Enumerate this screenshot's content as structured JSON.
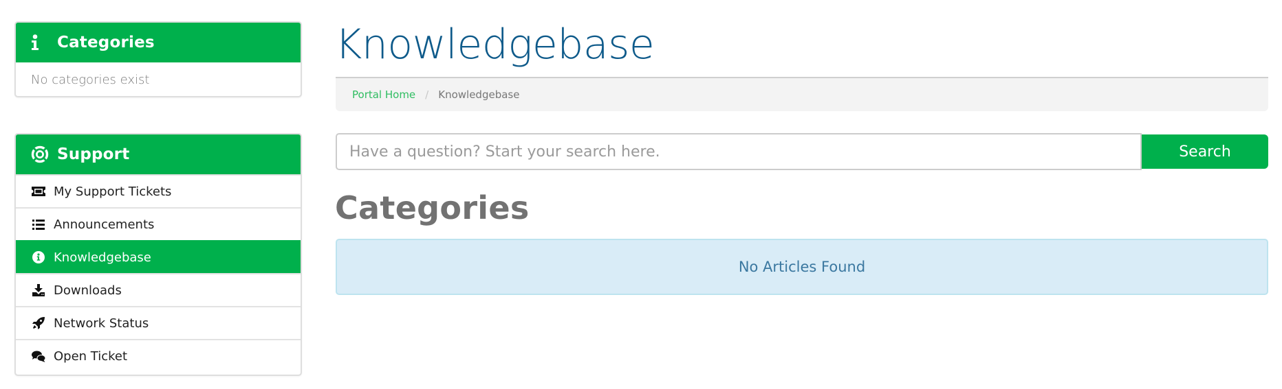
{
  "sidebar": {
    "categories_panel": {
      "title": "Categories",
      "icon": "info-icon",
      "empty_text": "No categories exist"
    },
    "support_panel": {
      "title": "Support",
      "icon": "life-ring-icon",
      "items": [
        {
          "label": "My Support Tickets",
          "icon": "ticket-icon",
          "active": false
        },
        {
          "label": "Announcements",
          "icon": "list-icon",
          "active": false
        },
        {
          "label": "Knowledgebase",
          "icon": "info-circle-icon",
          "active": true
        },
        {
          "label": "Downloads",
          "icon": "download-icon",
          "active": false
        },
        {
          "label": "Network Status",
          "icon": "rocket-icon",
          "active": false
        },
        {
          "label": "Open Ticket",
          "icon": "comments-icon",
          "active": false
        }
      ]
    }
  },
  "main": {
    "title": "Knowledgebase",
    "breadcrumb": {
      "home": "Portal Home",
      "separator": "/",
      "current": "Knowledgebase"
    },
    "search": {
      "placeholder": "Have a question? Start your search here.",
      "value": "",
      "button_label": "Search"
    },
    "section_title": "Categories",
    "alert_text": "No Articles Found"
  },
  "colors": {
    "brand_green": "#00b04c",
    "title_blue": "#0e5a8a",
    "link_green": "#2fbd61",
    "alert_bg": "#d9ecf7",
    "alert_text": "#3b78a0"
  }
}
